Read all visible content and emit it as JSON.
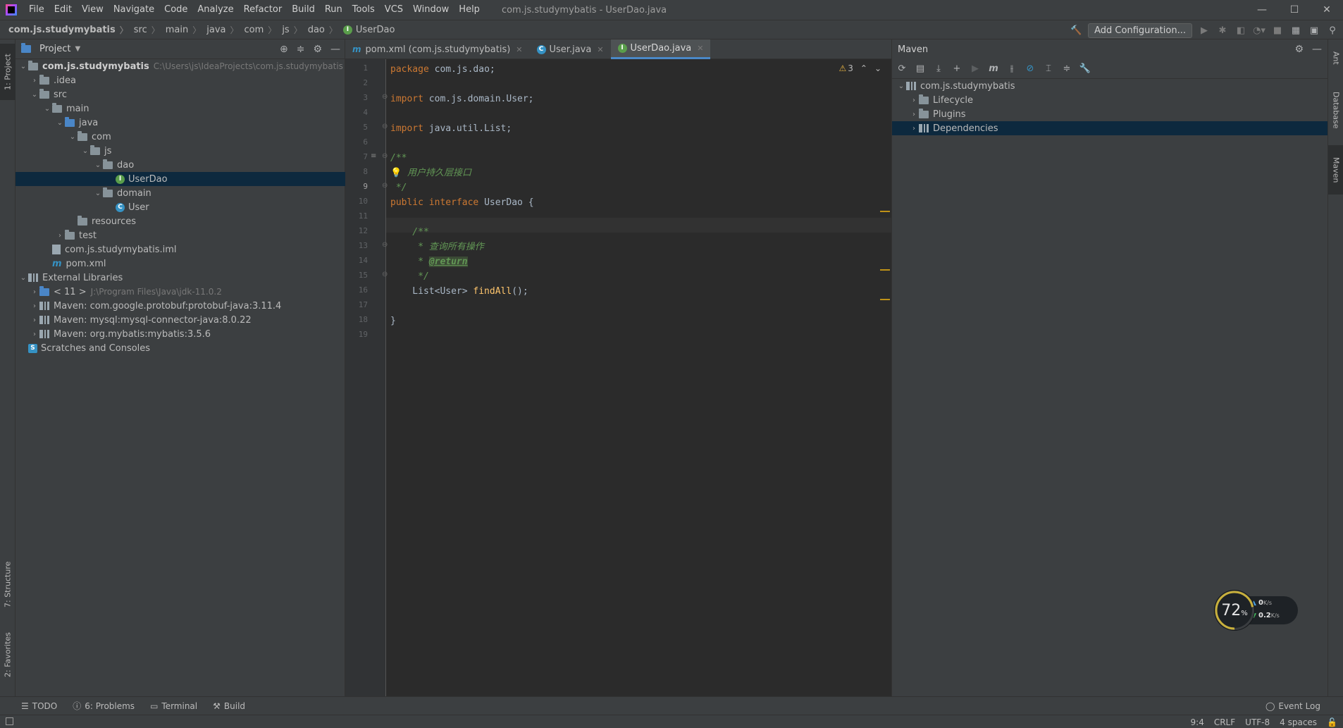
{
  "menu": {
    "items": [
      "File",
      "Edit",
      "View",
      "Navigate",
      "Code",
      "Analyze",
      "Refactor",
      "Build",
      "Run",
      "Tools",
      "VCS",
      "Window",
      "Help"
    ],
    "window_title": "com.js.studymybatis - UserDao.java"
  },
  "window_controls": {
    "minimize": "—",
    "maximize": "☐",
    "close": "✕"
  },
  "breadcrumb": [
    "com.js.studymybatis",
    "src",
    "main",
    "java",
    "com",
    "js",
    "dao",
    "UserDao"
  ],
  "toolbar": {
    "add_config_label": "Add Configuration..."
  },
  "left_stripe": {
    "project": "1: Project",
    "structure": "7: Structure",
    "favorites": "2: Favorites"
  },
  "project_panel": {
    "title": "Project",
    "tree": [
      {
        "label": "com.js.studymybatis",
        "hint": "C:\\Users\\js\\IdeaProjects\\com.js.studymybatis",
        "bold": true
      },
      {
        "label": ".idea"
      },
      {
        "label": "src"
      },
      {
        "label": "main"
      },
      {
        "label": "java"
      },
      {
        "label": "com"
      },
      {
        "label": "js"
      },
      {
        "label": "dao"
      },
      {
        "label": "UserDao"
      },
      {
        "label": "domain"
      },
      {
        "label": "User"
      },
      {
        "label": "resources"
      },
      {
        "label": "test"
      },
      {
        "label": "com.js.studymybatis.iml"
      },
      {
        "label": "pom.xml"
      },
      {
        "label": "External Libraries"
      },
      {
        "label": "< 11 >",
        "hint": "J:\\Program Files\\Java\\jdk-11.0.2"
      },
      {
        "label": "Maven: com.google.protobuf:protobuf-java:3.11.4"
      },
      {
        "label": "Maven: mysql:mysql-connector-java:8.0.22"
      },
      {
        "label": "Maven: org.mybatis:mybatis:3.5.6"
      },
      {
        "label": "Scratches and Consoles"
      }
    ]
  },
  "editor": {
    "tabs": [
      {
        "label": "pom.xml (com.js.studymybatis)",
        "icon": "m"
      },
      {
        "label": "User.java",
        "icon": "C"
      },
      {
        "label": "UserDao.java",
        "icon": "I"
      }
    ],
    "active_tab": 2,
    "warnings": "3",
    "current_line": "9",
    "line_numbers": [
      "1",
      "2",
      "3",
      "4",
      "5",
      "6",
      "7",
      "8",
      "9",
      "10",
      "11",
      "12",
      "13",
      "14",
      "15",
      "16",
      "17",
      "18",
      "19"
    ],
    "code": {
      "l1_kw": "package",
      "l1_rest": " com.js.dao;",
      "l3_kw": "import",
      "l3_rest": " com.js.domain.User;",
      "l5_kw": "import",
      "l5_rest": " java.util.List;",
      "l7": "/**",
      "l8": " 用户持久层接口",
      "l9": " */",
      "l10_kw1": "public",
      "l10_kw2": " interface",
      "l10_name": " UserDao",
      "l10_brace": " {",
      "l12": "    /**",
      "l13": "     * 查询所有操作",
      "l14_star": "     * ",
      "l14_tag": "@return",
      "l15": "     */",
      "l16_type": "    List<User> ",
      "l16_fn": "findAll",
      "l16_end": "();",
      "l18": "}"
    }
  },
  "maven_panel": {
    "title": "Maven",
    "tree": [
      {
        "label": "com.js.studymybatis"
      },
      {
        "label": "Lifecycle"
      },
      {
        "label": "Plugins"
      },
      {
        "label": "Dependencies"
      }
    ]
  },
  "right_stripe": {
    "ant": "Ant",
    "database": "Database",
    "maven": "Maven"
  },
  "tool_windows": {
    "todo": "TODO",
    "problems": "6: Problems",
    "terminal": "Terminal",
    "build": "Build",
    "event_log": "Event Log"
  },
  "status_bar": {
    "position": "9:4",
    "line_sep": "CRLF",
    "encoding": "UTF-8",
    "indent": "4 spaces"
  },
  "net_monitor": {
    "percent": "72",
    "percent_unit": "%",
    "upload": "0",
    "download": "0.2",
    "unit": "K/s"
  }
}
